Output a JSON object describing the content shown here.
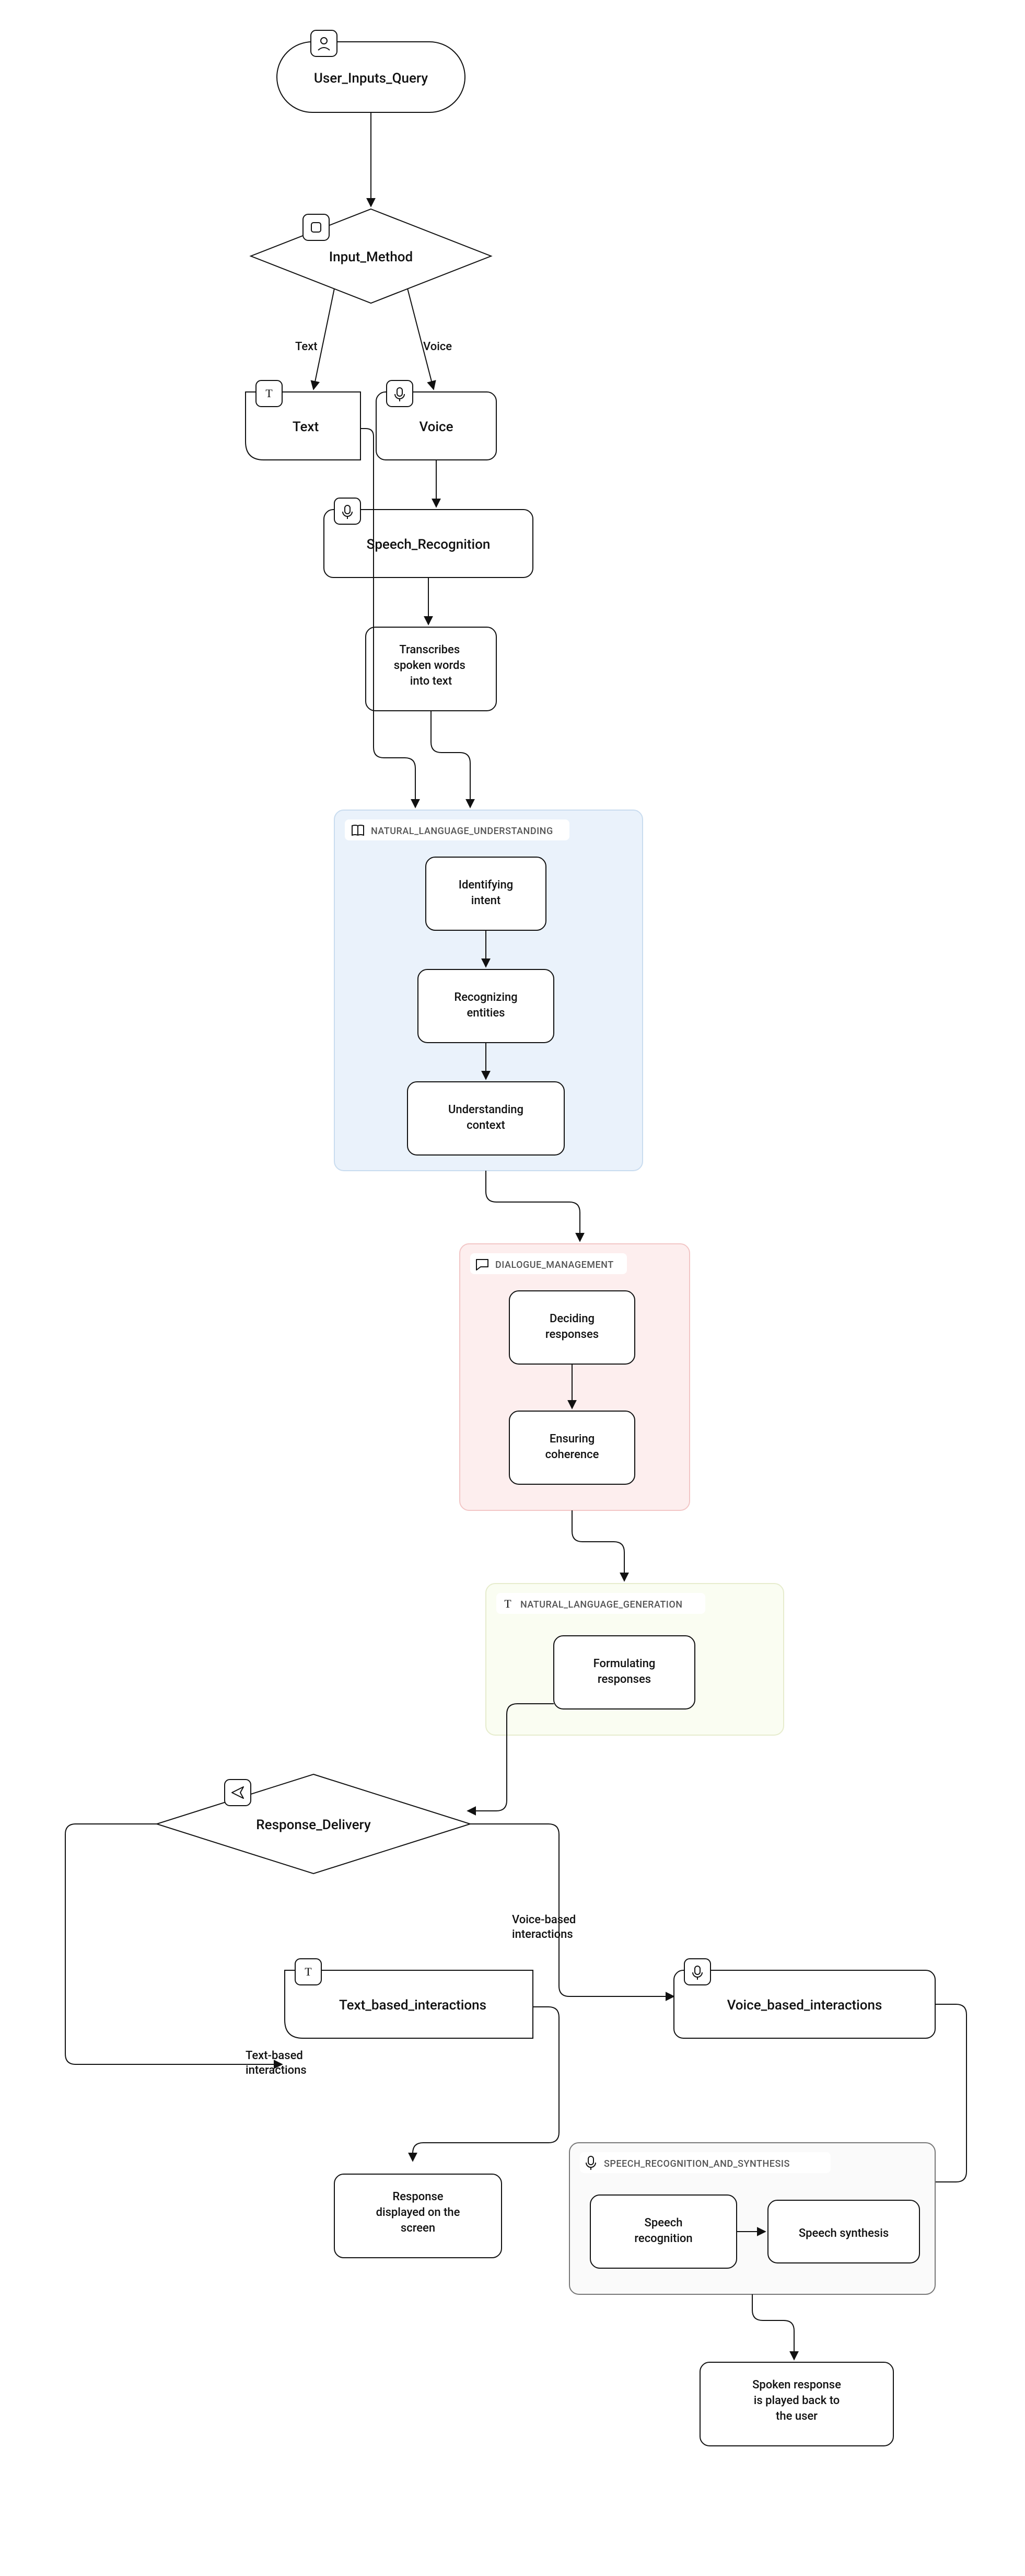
{
  "nodes": {
    "user_inputs_query": "User_Inputs_Query",
    "input_method": "Input_Method",
    "text": "Text",
    "voice": "Voice",
    "speech_recognition": "Speech_Recognition",
    "transcribes": "Transcribes spoken words into text",
    "identifying_intent": "Identifying intent",
    "recognizing_entities": "Recognizing entities",
    "understanding_context": "Understanding context",
    "deciding_responses": "Deciding responses",
    "ensuring_coherence": "Ensuring coherence",
    "formulating_responses": "Formulating responses",
    "response_delivery": "Response_Delivery",
    "text_based_interactions": "Text_based_interactions",
    "voice_based_interactions": "Voice_based_interactions",
    "response_displayed": "Response displayed on the screen",
    "speech_recognition2": "Speech recognition",
    "speech_synthesis": "Speech synthesis",
    "spoken_response": "Spoken response is played back to the user"
  },
  "clusters": {
    "nlu": "NATURAL_LANGUAGE_UNDERSTANDING",
    "dm": "DIALOGUE_MANAGEMENT",
    "nlg": "NATURAL_LANGUAGE_GENERATION",
    "srs": "SPEECH_RECOGNITION_AND_SYNTHESIS"
  },
  "edges": {
    "text_branch": "Text",
    "voice_branch": "Voice",
    "voice_interactions": "Voice-based interactions",
    "text_interactions": "Text-based interactions"
  }
}
